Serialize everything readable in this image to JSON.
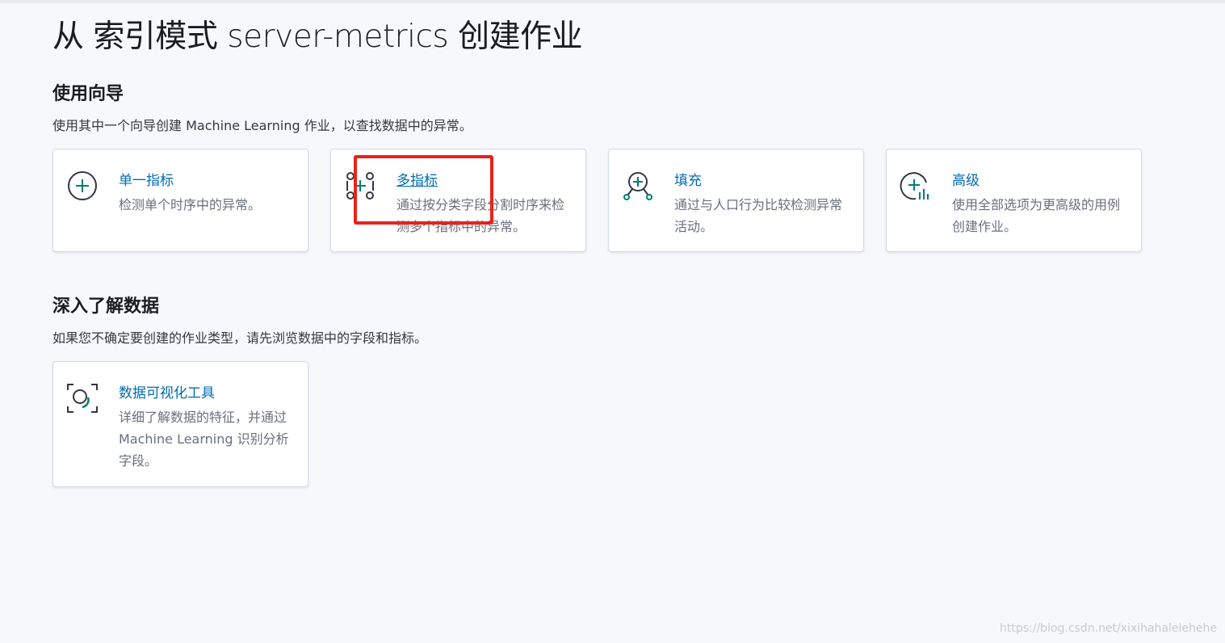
{
  "page": {
    "title": "从 索引模式 server-metrics 创建作业"
  },
  "wizard": {
    "title": "使用向导",
    "description": "使用其中一个向导创建 Machine Learning 作业，以查找数据中的异常。",
    "cards": [
      {
        "title": "单一指标",
        "description": "检测单个时序中的异常。",
        "icon": "plus-circle-icon"
      },
      {
        "title": "多指标",
        "description": "通过按分类字段分割时序来检测多个指标中的异常。",
        "icon": "multi-metric-icon"
      },
      {
        "title": "填充",
        "description": "通过与人口行为比较检测异常活动。",
        "icon": "population-icon"
      },
      {
        "title": "高级",
        "description": "使用全部选项为更高级的用例创建作业。",
        "icon": "advanced-chart-icon"
      }
    ]
  },
  "explore": {
    "title": "深入了解数据",
    "description": "如果您不确定要创建的作业类型，请先浏览数据中的字段和指标。",
    "cards": [
      {
        "title": "数据可视化工具",
        "description": "详细了解数据的特征，并通过 Machine Learning 识别分析字段。",
        "icon": "data-visualizer-icon"
      }
    ]
  },
  "watermark": "https://blog.csdn.net/xixihahalelehehe",
  "colors": {
    "link": "#006bb4",
    "icon_dark": "#343741",
    "icon_accent": "#017d73",
    "highlight": "#e8231c"
  }
}
